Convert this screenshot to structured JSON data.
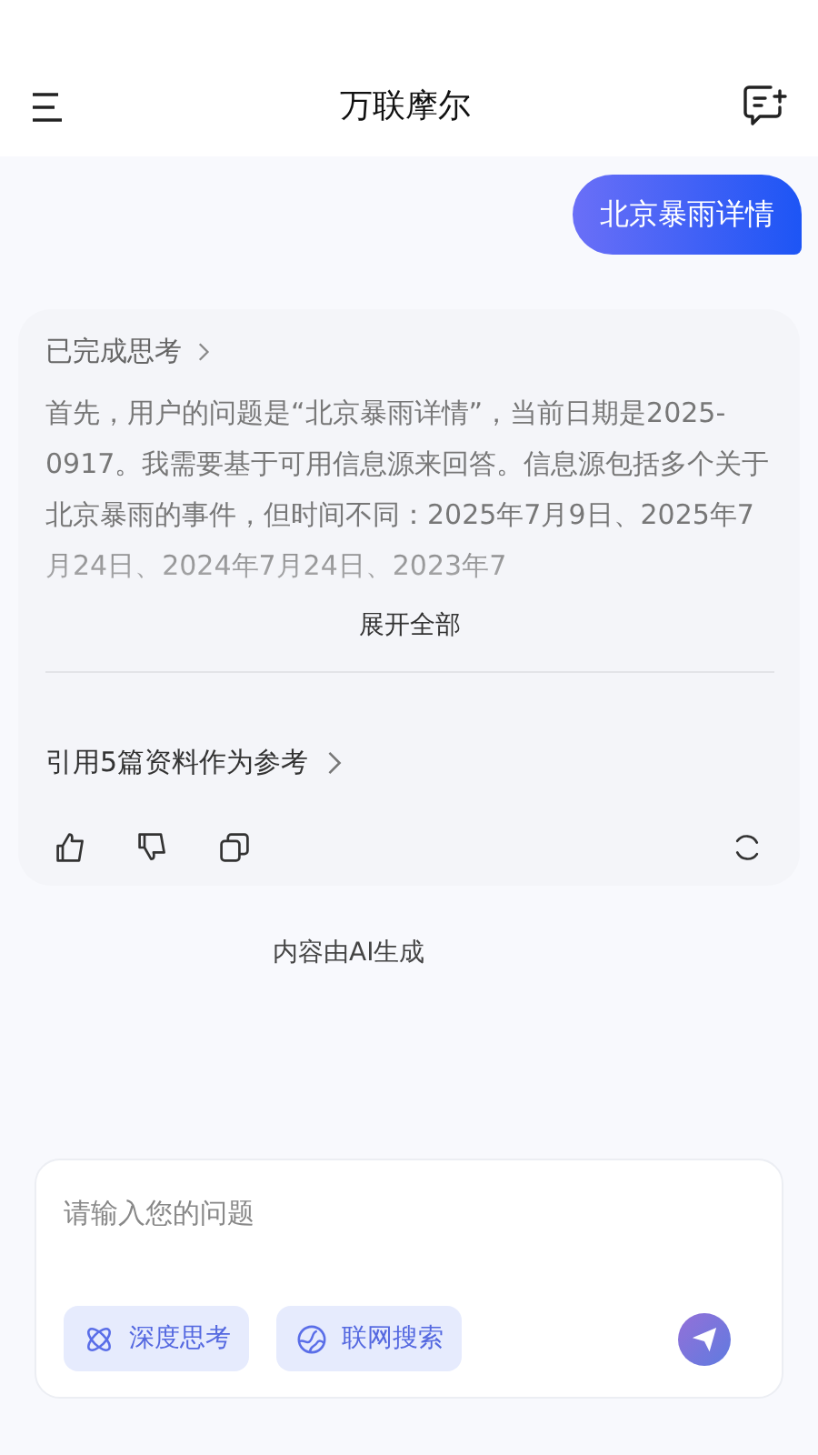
{
  "header": {
    "title": "万联摩尔"
  },
  "user_message": "北京暴雨详情",
  "answer": {
    "thinking_status": "已完成思考",
    "thinking_text": "首先，用户的问题是“北京暴雨详情”，当前日期是2025-0917。我需要基于可用信息源来回答。信息源包括多个关于北京暴雨的事件，但时间不同：2025年7月9日、2025年7月24日、2024年7月24日、2023年7",
    "expand_label": "展开全部",
    "references": "引用5篇资料作为参考"
  },
  "disclaimer": "内容由AI生成",
  "composer": {
    "placeholder": "请输入您的问题",
    "chips": [
      {
        "kind": "deep",
        "label": "深度思考"
      },
      {
        "kind": "web",
        "label": "联网搜索"
      }
    ]
  }
}
